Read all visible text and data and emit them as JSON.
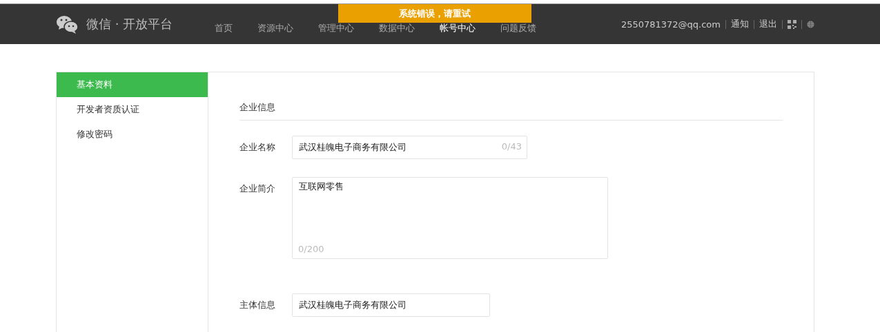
{
  "header": {
    "logo_text": "微信 · 开放平台",
    "nav": [
      {
        "label": "首页",
        "selected": false
      },
      {
        "label": "资源中心",
        "selected": false
      },
      {
        "label": "管理中心",
        "selected": false
      },
      {
        "label": "数据中心",
        "selected": false
      },
      {
        "label": "帐号中心",
        "selected": true
      },
      {
        "label": "问题反馈",
        "selected": false
      }
    ],
    "account": "2550781372@qq.com",
    "links": [
      "通知",
      "退出"
    ]
  },
  "toast": {
    "message": "系统错误，请重试"
  },
  "sidebar": {
    "items": [
      {
        "label": "基本资料",
        "selected": true
      },
      {
        "label": "开发者资质认证",
        "selected": false
      },
      {
        "label": "修改密码",
        "selected": false
      }
    ]
  },
  "section_title": "企业信息",
  "fields": [
    {
      "kind": "input",
      "label": "企业名称",
      "value": "武汉桂魄电子商务有限公司",
      "counter": "0/43"
    },
    {
      "kind": "textarea",
      "label": "企业简介",
      "value": "互联网零售",
      "counter": "0/200"
    },
    {
      "kind": "plain",
      "label": "主体信息",
      "value": "武汉桂魄电子商务有限公司"
    }
  ]
}
